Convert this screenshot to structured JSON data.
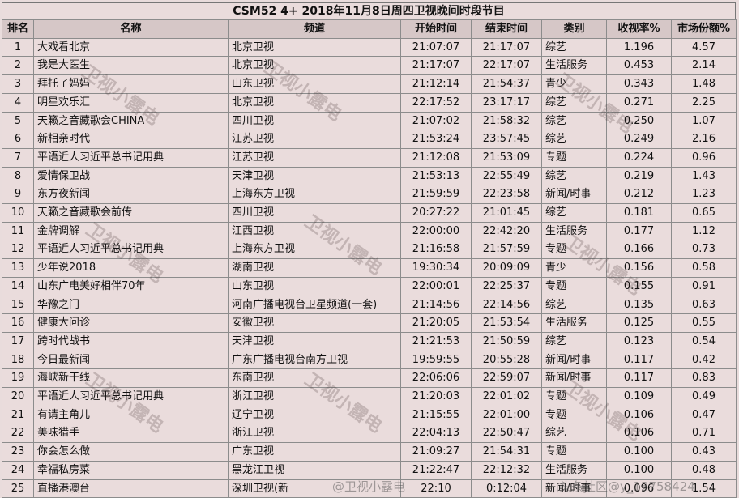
{
  "title": "CSM52 4+ 2018年11月8日周四卫视晚间时段节目",
  "headers": [
    "排名",
    "名称",
    "频道",
    "开始时间",
    "结束时间",
    "类别",
    "收视率%",
    "市场份额%"
  ],
  "rows": [
    [
      "1",
      "大戏看北京",
      "北京卫视",
      "21:07:07",
      "21:17:07",
      "综艺",
      "1.196",
      "4.57"
    ],
    [
      "2",
      "我是大医生",
      "北京卫视",
      "21:17:07",
      "22:17:07",
      "生活服务",
      "0.453",
      "2.14"
    ],
    [
      "3",
      "拜托了妈妈",
      "山东卫视",
      "21:12:14",
      "21:54:37",
      "青少",
      "0.343",
      "1.48"
    ],
    [
      "4",
      "明星欢乐汇",
      "北京卫视",
      "22:17:52",
      "23:17:17",
      "综艺",
      "0.271",
      "2.25"
    ],
    [
      "5",
      "天籁之音藏歌会CHINA",
      "四川卫视",
      "21:07:02",
      "21:58:32",
      "综艺",
      "0.250",
      "1.07"
    ],
    [
      "6",
      "新相亲时代",
      "江苏卫视",
      "21:53:24",
      "23:57:45",
      "综艺",
      "0.249",
      "2.16"
    ],
    [
      "7",
      "平语近人习近平总书记用典",
      "江苏卫视",
      "21:12:08",
      "21:53:09",
      "专题",
      "0.224",
      "0.96"
    ],
    [
      "8",
      "爱情保卫战",
      "天津卫视",
      "21:53:13",
      "22:55:49",
      "综艺",
      "0.219",
      "1.43"
    ],
    [
      "9",
      "东方夜新闻",
      "上海东方卫视",
      "21:59:59",
      "22:23:58",
      "新闻/时事",
      "0.212",
      "1.23"
    ],
    [
      "10",
      "天籁之音藏歌会前传",
      "四川卫视",
      "20:27:22",
      "21:01:45",
      "综艺",
      "0.181",
      "0.65"
    ],
    [
      "11",
      "金牌调解",
      "江西卫视",
      "22:00:00",
      "22:42:20",
      "生活服务",
      "0.177",
      "1.12"
    ],
    [
      "12",
      "平语近人习近平总书记用典",
      "上海东方卫视",
      "21:16:58",
      "21:57:59",
      "专题",
      "0.166",
      "0.73"
    ],
    [
      "13",
      "少年说2018",
      "湖南卫视",
      "19:30:34",
      "20:09:09",
      "青少",
      "0.156",
      "0.58"
    ],
    [
      "14",
      "山东广电美好相伴70年",
      "山东卫视",
      "22:00:01",
      "22:25:37",
      "专题",
      "0.155",
      "0.91"
    ],
    [
      "15",
      "华豫之门",
      "河南广播电视台卫星频道(一套)",
      "21:14:56",
      "22:14:56",
      "综艺",
      "0.135",
      "0.63"
    ],
    [
      "16",
      "健康大问诊",
      "安徽卫视",
      "21:20:05",
      "21:53:54",
      "生活服务",
      "0.125",
      "0.55"
    ],
    [
      "17",
      "跨时代战书",
      "天津卫视",
      "21:21:53",
      "21:50:59",
      "综艺",
      "0.123",
      "0.54"
    ],
    [
      "18",
      "今日最新闻",
      "广东广播电视台南方卫视",
      "19:59:55",
      "20:55:28",
      "新闻/时事",
      "0.117",
      "0.42"
    ],
    [
      "19",
      "海峡新干线",
      "东南卫视",
      "22:06:06",
      "22:59:07",
      "新闻/时事",
      "0.117",
      "0.83"
    ],
    [
      "20",
      "平语近人习近平总书记用典",
      "浙江卫视",
      "21:20:03",
      "22:01:02",
      "专题",
      "0.109",
      "0.49"
    ],
    [
      "21",
      "有请主角儿",
      "辽宁卫视",
      "21:15:55",
      "22:01:00",
      "专题",
      "0.106",
      "0.47"
    ],
    [
      "22",
      "美味猎手",
      "浙江卫视",
      "22:04:13",
      "22:50:47",
      "综艺",
      "0.106",
      "0.71"
    ],
    [
      "23",
      "你会怎么做",
      "广东卫视",
      "21:09:27",
      "21:54:31",
      "专题",
      "0.100",
      "0.43"
    ],
    [
      "24",
      "幸福私房菜",
      "黑龙江卫视",
      "21:22:47",
      "22:12:32",
      "生活服务",
      "0.100",
      "0.48"
    ],
    [
      "25",
      "直播港澳台",
      "深圳卫视(新",
      "22:10",
      "0:12:04",
      "新闻/时事",
      "0.096",
      "1.54"
    ]
  ],
  "watermark": "卫视小露电",
  "footer_left": "@卫视小露电",
  "footer_right": "头条社区@y_13758424"
}
